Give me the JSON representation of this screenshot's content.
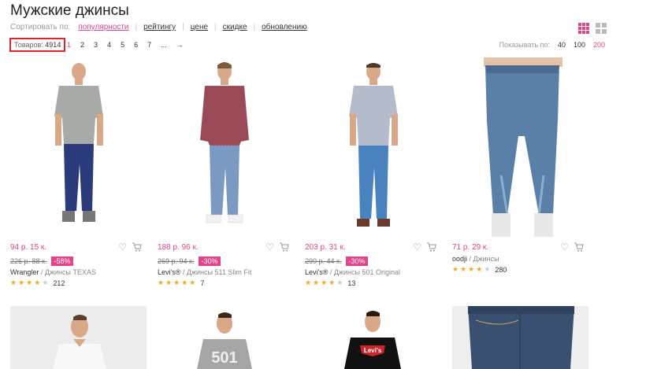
{
  "page": {
    "title": "Мужские джинсы"
  },
  "sort": {
    "label": "Сортировать по:",
    "options": [
      {
        "label": "популярности",
        "active": true
      },
      {
        "label": "рейтингу",
        "active": false
      },
      {
        "label": "цене",
        "active": false
      },
      {
        "label": "скидке",
        "active": false
      },
      {
        "label": "обновлению",
        "active": false
      }
    ]
  },
  "view_icons": [
    "grid-4-icon",
    "grid-2-icon"
  ],
  "count": {
    "label": "Товаров:",
    "value": "4914"
  },
  "pagination": {
    "pages": [
      "1",
      "2",
      "3",
      "4",
      "5",
      "6",
      "7"
    ],
    "ellipsis": "...",
    "next": "→",
    "current": "1"
  },
  "per_page": {
    "label": "Показывать по:",
    "options": [
      "40",
      "100",
      "200"
    ],
    "selected": "200"
  },
  "products": [
    {
      "price": "94 р. 15 к.",
      "old_price": "226 р. 88 к.",
      "discount": "-58%",
      "brand": "Wrangler",
      "sep": " / ",
      "model": "Джинсы TEXAS",
      "rating": 4,
      "reviews": "212"
    },
    {
      "price": "188 р. 96 к.",
      "old_price": "269 р. 94 к.",
      "discount": "-30%",
      "brand": "Levi's®",
      "sep": " / ",
      "model": "Джинсы 511 Slim Fit",
      "rating": 5,
      "reviews": "7"
    },
    {
      "price": "203 р. 31 к.",
      "old_price": "290 р. 44 к.",
      "discount": "-30%",
      "brand": "Levi's®",
      "sep": " / ",
      "model": "Джинсы 501 Original",
      "rating": 4,
      "reviews": "13"
    },
    {
      "price": "71 р. 29 к.",
      "old_price": "",
      "discount": "",
      "brand": "oodji",
      "sep": " / ",
      "model": "Джинсы",
      "rating": 4,
      "reviews": "280"
    }
  ],
  "bottom_tiles": [
    {
      "icon": "white-shirt-model-photo"
    },
    {
      "icon": "grey-501-tshirt-model-photo",
      "print": "501"
    },
    {
      "icon": "black-levis-tshirt-model-photo",
      "print": "Levi's"
    },
    {
      "icon": "jeans-closeup-photo"
    }
  ],
  "colors": {
    "accent": "#e5448a",
    "highlight_box": "#d8262b",
    "star": "#f5a623"
  }
}
